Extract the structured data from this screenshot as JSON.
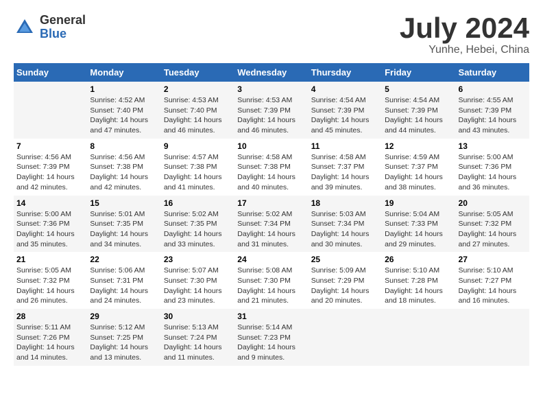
{
  "header": {
    "logo_general": "General",
    "logo_blue": "Blue",
    "month_title": "July 2024",
    "location": "Yunhe, Hebei, China"
  },
  "weekdays": [
    "Sunday",
    "Monday",
    "Tuesday",
    "Wednesday",
    "Thursday",
    "Friday",
    "Saturday"
  ],
  "weeks": [
    [
      {
        "day": "",
        "sunrise": "",
        "sunset": "",
        "daylight": ""
      },
      {
        "day": "1",
        "sunrise": "4:52 AM",
        "sunset": "7:40 PM",
        "daylight": "14 hours and 47 minutes."
      },
      {
        "day": "2",
        "sunrise": "4:53 AM",
        "sunset": "7:40 PM",
        "daylight": "14 hours and 46 minutes."
      },
      {
        "day": "3",
        "sunrise": "4:53 AM",
        "sunset": "7:39 PM",
        "daylight": "14 hours and 46 minutes."
      },
      {
        "day": "4",
        "sunrise": "4:54 AM",
        "sunset": "7:39 PM",
        "daylight": "14 hours and 45 minutes."
      },
      {
        "day": "5",
        "sunrise": "4:54 AM",
        "sunset": "7:39 PM",
        "daylight": "14 hours and 44 minutes."
      },
      {
        "day": "6",
        "sunrise": "4:55 AM",
        "sunset": "7:39 PM",
        "daylight": "14 hours and 43 minutes."
      }
    ],
    [
      {
        "day": "7",
        "sunrise": "4:56 AM",
        "sunset": "7:39 PM",
        "daylight": "14 hours and 42 minutes."
      },
      {
        "day": "8",
        "sunrise": "4:56 AM",
        "sunset": "7:38 PM",
        "daylight": "14 hours and 42 minutes."
      },
      {
        "day": "9",
        "sunrise": "4:57 AM",
        "sunset": "7:38 PM",
        "daylight": "14 hours and 41 minutes."
      },
      {
        "day": "10",
        "sunrise": "4:58 AM",
        "sunset": "7:38 PM",
        "daylight": "14 hours and 40 minutes."
      },
      {
        "day": "11",
        "sunrise": "4:58 AM",
        "sunset": "7:37 PM",
        "daylight": "14 hours and 39 minutes."
      },
      {
        "day": "12",
        "sunrise": "4:59 AM",
        "sunset": "7:37 PM",
        "daylight": "14 hours and 38 minutes."
      },
      {
        "day": "13",
        "sunrise": "5:00 AM",
        "sunset": "7:36 PM",
        "daylight": "14 hours and 36 minutes."
      }
    ],
    [
      {
        "day": "14",
        "sunrise": "5:00 AM",
        "sunset": "7:36 PM",
        "daylight": "14 hours and 35 minutes."
      },
      {
        "day": "15",
        "sunrise": "5:01 AM",
        "sunset": "7:35 PM",
        "daylight": "14 hours and 34 minutes."
      },
      {
        "day": "16",
        "sunrise": "5:02 AM",
        "sunset": "7:35 PM",
        "daylight": "14 hours and 33 minutes."
      },
      {
        "day": "17",
        "sunrise": "5:02 AM",
        "sunset": "7:34 PM",
        "daylight": "14 hours and 31 minutes."
      },
      {
        "day": "18",
        "sunrise": "5:03 AM",
        "sunset": "7:34 PM",
        "daylight": "14 hours and 30 minutes."
      },
      {
        "day": "19",
        "sunrise": "5:04 AM",
        "sunset": "7:33 PM",
        "daylight": "14 hours and 29 minutes."
      },
      {
        "day": "20",
        "sunrise": "5:05 AM",
        "sunset": "7:32 PM",
        "daylight": "14 hours and 27 minutes."
      }
    ],
    [
      {
        "day": "21",
        "sunrise": "5:05 AM",
        "sunset": "7:32 PM",
        "daylight": "14 hours and 26 minutes."
      },
      {
        "day": "22",
        "sunrise": "5:06 AM",
        "sunset": "7:31 PM",
        "daylight": "14 hours and 24 minutes."
      },
      {
        "day": "23",
        "sunrise": "5:07 AM",
        "sunset": "7:30 PM",
        "daylight": "14 hours and 23 minutes."
      },
      {
        "day": "24",
        "sunrise": "5:08 AM",
        "sunset": "7:30 PM",
        "daylight": "14 hours and 21 minutes."
      },
      {
        "day": "25",
        "sunrise": "5:09 AM",
        "sunset": "7:29 PM",
        "daylight": "14 hours and 20 minutes."
      },
      {
        "day": "26",
        "sunrise": "5:10 AM",
        "sunset": "7:28 PM",
        "daylight": "14 hours and 18 minutes."
      },
      {
        "day": "27",
        "sunrise": "5:10 AM",
        "sunset": "7:27 PM",
        "daylight": "14 hours and 16 minutes."
      }
    ],
    [
      {
        "day": "28",
        "sunrise": "5:11 AM",
        "sunset": "7:26 PM",
        "daylight": "14 hours and 14 minutes."
      },
      {
        "day": "29",
        "sunrise": "5:12 AM",
        "sunset": "7:25 PM",
        "daylight": "14 hours and 13 minutes."
      },
      {
        "day": "30",
        "sunrise": "5:13 AM",
        "sunset": "7:24 PM",
        "daylight": "14 hours and 11 minutes."
      },
      {
        "day": "31",
        "sunrise": "5:14 AM",
        "sunset": "7:23 PM",
        "daylight": "14 hours and 9 minutes."
      },
      {
        "day": "",
        "sunrise": "",
        "sunset": "",
        "daylight": ""
      },
      {
        "day": "",
        "sunrise": "",
        "sunset": "",
        "daylight": ""
      },
      {
        "day": "",
        "sunrise": "",
        "sunset": "",
        "daylight": ""
      }
    ]
  ]
}
